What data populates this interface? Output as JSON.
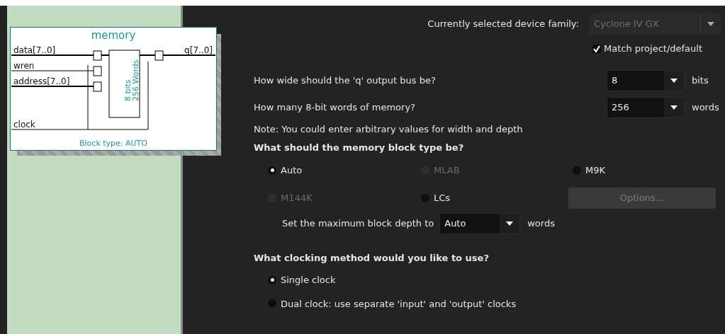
{
  "diagram": {
    "title": "memory",
    "inputs": [
      "data[7..0]",
      "wren",
      "address[7..0]",
      "clock"
    ],
    "output": "q[7..0]",
    "block_lines": [
      "8 bits",
      "256 Words"
    ],
    "footer": "Block type: AUTO"
  },
  "device_family": {
    "label": "Currently selected device family:",
    "value": "Cyclone IV GX",
    "disabled": true
  },
  "match_checkbox": {
    "label": "Match project/default",
    "checked": true
  },
  "width_question": {
    "label": "How wide should the 'q' output bus be?",
    "value": "8",
    "unit": "bits"
  },
  "depth_question": {
    "label": "How many 8-bit words of memory?",
    "value": "256",
    "unit": "words"
  },
  "note": "Note: You could enter arbitrary values for width and depth",
  "block_type": {
    "heading": "What should the memory block type be?",
    "options": [
      {
        "label": "Auto",
        "selected": true,
        "disabled": false
      },
      {
        "label": "MLAB",
        "selected": false,
        "disabled": true
      },
      {
        "label": "M9K",
        "selected": false,
        "disabled": false
      },
      {
        "label": "M144K",
        "selected": false,
        "disabled": true
      },
      {
        "label": "LCs",
        "selected": false,
        "disabled": false
      }
    ],
    "options_button": {
      "label": "Options...",
      "disabled": true
    },
    "max_depth": {
      "label": "Set the maximum block depth to",
      "value": "Auto",
      "unit": "words"
    }
  },
  "clocking": {
    "heading": "What clocking method would you like to use?",
    "options": [
      {
        "label": "Single clock",
        "selected": true,
        "disabled": false
      },
      {
        "label": "Dual clock: use separate 'input' and 'output' clocks",
        "selected": false,
        "disabled": false
      }
    ]
  }
}
